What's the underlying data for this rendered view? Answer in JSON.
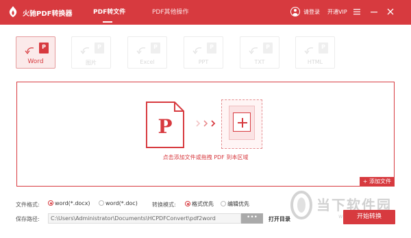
{
  "app": {
    "title": "火驰PDF转换器",
    "accent_color": "#d73a3f"
  },
  "nav": {
    "tabs": [
      {
        "label": "PDF转文件",
        "active": true
      },
      {
        "label": "PDF其他操作",
        "active": false
      }
    ]
  },
  "account": {
    "login_label": "请登录",
    "vip_label": "开通VIP"
  },
  "window_controls": [
    "menu-icon",
    "minimize-icon",
    "close-icon"
  ],
  "formats": [
    {
      "label": "Word",
      "letter": "P",
      "active": true
    },
    {
      "label": "图片",
      "letter": "P",
      "active": false
    },
    {
      "label": "Excel",
      "letter": "P",
      "active": false
    },
    {
      "label": "PPT",
      "letter": "P",
      "active": false
    },
    {
      "label": "TXT",
      "letter": "P",
      "active": false
    },
    {
      "label": "HTML",
      "letter": "P",
      "active": false
    }
  ],
  "drop_area": {
    "doc_letter": "P",
    "hint": "点击添加文件或拖拽 PDF 到本区域",
    "add_file_label": "+ 添加文件"
  },
  "options": {
    "format_label": "文件格式:",
    "format_options": [
      {
        "label": "word(*.docx)",
        "selected": true
      },
      {
        "label": "word(*.doc)",
        "selected": false
      }
    ],
    "mode_label": "转换模式:",
    "mode_options": [
      {
        "label": "格式优先",
        "selected": true
      },
      {
        "label": "编辑优先",
        "selected": false
      }
    ],
    "save_path_label": "保存路径:",
    "save_path_value": "C:\\Users\\Administrator\\Documents\\HCPDFConvert\\pdf2word",
    "browse_label": "•••",
    "open_dir_label": "打开目录",
    "start_label": "开始转换"
  },
  "watermark": {
    "text": "当下软件园",
    "sub": "www.downxia.com"
  }
}
